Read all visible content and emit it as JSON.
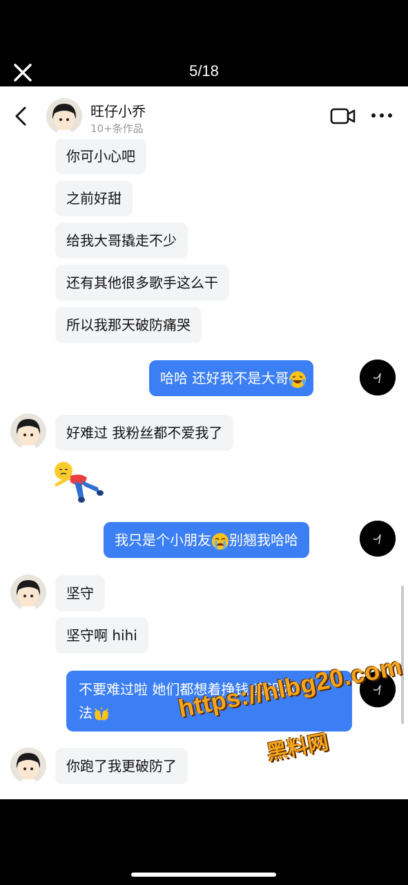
{
  "viewer": {
    "counter": "5/18"
  },
  "header": {
    "name": "旺仔小乔",
    "subtitle": "10+条作品"
  },
  "messages": [
    {
      "text": "你可小心吧"
    },
    {
      "text": "之前好甜"
    },
    {
      "text": "给我大哥撬走不少"
    },
    {
      "text": "还有其他很多歌手这么干"
    },
    {
      "text": "所以我那天破防痛哭"
    },
    {
      "text": "哈哈 还好我不是大哥"
    },
    {
      "text": "好难过 我粉丝都不爱我了"
    },
    {
      "text": "我只是个小朋友",
      "text2": "别翘我哈哈"
    },
    {
      "text": "坚守"
    },
    {
      "text": "坚守啊 hihi"
    },
    {
      "text": "不要难过啦 她们都想着挣钱 真没办",
      "text2": "法"
    },
    {
      "text": "你跑了我更破防了"
    }
  ],
  "watermark": {
    "url": "https://hlbg20.com",
    "label": "黑料网"
  },
  "colors": {
    "outgoing": "#3c7ff5",
    "incoming": "#f3f4f6",
    "watermark": "#f6a61c"
  },
  "icons": [
    "close-icon",
    "back-icon",
    "video-call-icon",
    "more-icon",
    "laughing-tears-emoji",
    "crying-emoji",
    "clapping-hands-emoji"
  ]
}
